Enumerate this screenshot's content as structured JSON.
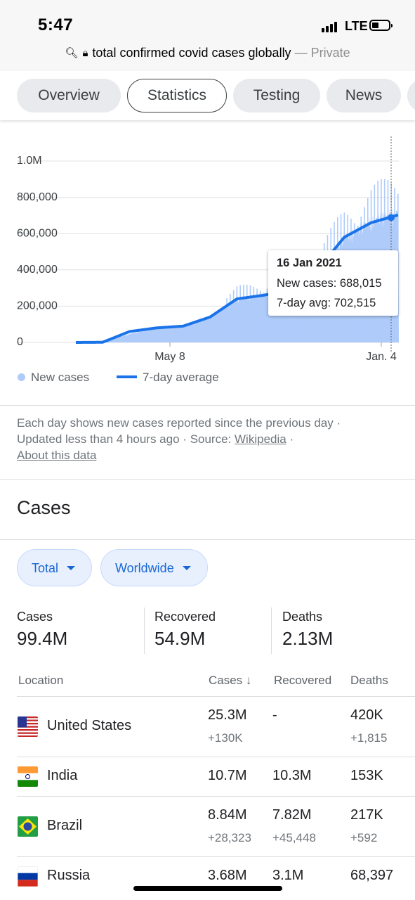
{
  "status_bar": {
    "time": "5:47",
    "network": "LTE"
  },
  "browser": {
    "query": "total confirmed covid cases globally",
    "private_label": "— Private"
  },
  "tabs": [
    {
      "label": "Overview",
      "active": false
    },
    {
      "label": "Statistics",
      "active": true
    },
    {
      "label": "Testing",
      "active": false
    },
    {
      "label": "News",
      "active": false
    }
  ],
  "chart_data": {
    "type": "bar",
    "y_ticks": [
      "0",
      "200,000",
      "400,000",
      "600,000",
      "800,000",
      "1.0M"
    ],
    "x_ticks": [
      "May 8",
      "Jan. 4"
    ],
    "ylim": [
      0,
      1000000
    ],
    "series": [
      {
        "name": "New cases",
        "kind": "bar",
        "color": "#aecbfa",
        "values_by_month": {
          "Jan": 2000,
          "Feb": 2000,
          "Mar": 45000,
          "Apr": 80000,
          "May": 90000,
          "Jun": 140000,
          "Jul": 230000,
          "Aug": 260000,
          "Sep": 290000,
          "Oct": 380000,
          "Nov": 560000,
          "Dec": 650000,
          "Jan 2021": 700000
        }
      },
      {
        "name": "7-day average",
        "kind": "line",
        "color": "#1a73e8",
        "values_by_month": {
          "Jan": 0,
          "Feb": 1000,
          "Mar": 60000,
          "Apr": 80000,
          "May": 90000,
          "Jun": 140000,
          "Jul": 240000,
          "Aug": 260000,
          "Sep": 290000,
          "Oct": 400000,
          "Nov": 580000,
          "Dec": 660000,
          "Jan 2021": 702515
        }
      }
    ],
    "tooltip": {
      "date": "16 Jan 2021",
      "new_cases_label": "New cases: 688,015",
      "avg_label": "7-day avg: 702,515"
    },
    "legend": {
      "new_cases": "New cases",
      "avg": "7-day average"
    }
  },
  "note": {
    "line1": "Each day shows new cases reported since the previous day ·",
    "updated": "Updated less than 4 hours ago",
    "source_label": "Source:",
    "source_link": "Wikipedia",
    "about": "About this data"
  },
  "cases": {
    "title": "Cases",
    "filters": {
      "total": "Total",
      "scope": "Worldwide"
    },
    "summary": [
      {
        "label": "Cases",
        "value": "99.4M"
      },
      {
        "label": "Recovered",
        "value": "54.9M"
      },
      {
        "label": "Deaths",
        "value": "2.13M"
      }
    ],
    "table": {
      "headers": {
        "location": "Location",
        "cases": "Cases",
        "recovered": "Recovered",
        "deaths": "Deaths"
      },
      "rows": [
        {
          "location": "United States",
          "cases": "25.3M",
          "cases_delta": "+130K",
          "recovered": "-",
          "recovered_delta": "",
          "deaths": "420K",
          "deaths_delta": "+1,815"
        },
        {
          "location": "India",
          "cases": "10.7M",
          "cases_delta": "",
          "recovered": "10.3M",
          "recovered_delta": "",
          "deaths": "153K",
          "deaths_delta": ""
        },
        {
          "location": "Brazil",
          "cases": "8.84M",
          "cases_delta": "+28,323",
          "recovered": "7.82M",
          "recovered_delta": "+45,448",
          "deaths": "217K",
          "deaths_delta": "+592"
        },
        {
          "location": "Russia",
          "cases": "3.68M",
          "cases_delta": "",
          "recovered": "3.1M",
          "recovered_delta": "",
          "deaths": "68,397",
          "deaths_delta": ""
        }
      ]
    }
  }
}
